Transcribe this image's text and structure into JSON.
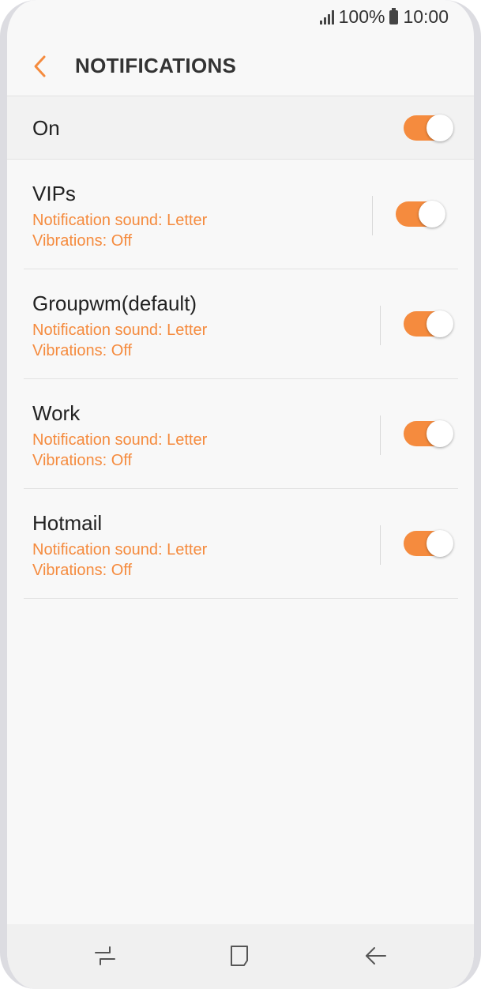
{
  "status_bar": {
    "battery_percent": "100%",
    "time": "10:00",
    "icons": [
      "signal-icon",
      "battery-icon"
    ]
  },
  "header": {
    "title": "NOTIFICATIONS",
    "back_icon": "back-arrow-icon"
  },
  "master_switch": {
    "label": "On",
    "enabled": true
  },
  "accounts": [
    {
      "name": "VIPs",
      "sound": "Notification sound: Letter",
      "vibration": "Vibrations: Off",
      "enabled": true
    },
    {
      "name": "Groupwm(default)",
      "sound": "Notification sound: Letter",
      "vibration": "Vibrations: Off",
      "enabled": true
    },
    {
      "name": "Work",
      "sound": "Notification sound: Letter",
      "vibration": "Vibrations: Off",
      "enabled": true
    },
    {
      "name": "Hotmail",
      "sound": "Notification sound: Letter",
      "vibration": "Vibrations: Off",
      "enabled": true
    }
  ],
  "nav_bar": {
    "icons": [
      "recent-apps-icon",
      "home-icon",
      "back-icon"
    ]
  },
  "colors": {
    "accent": "#f58b3e",
    "background": "#f8f8f8"
  }
}
